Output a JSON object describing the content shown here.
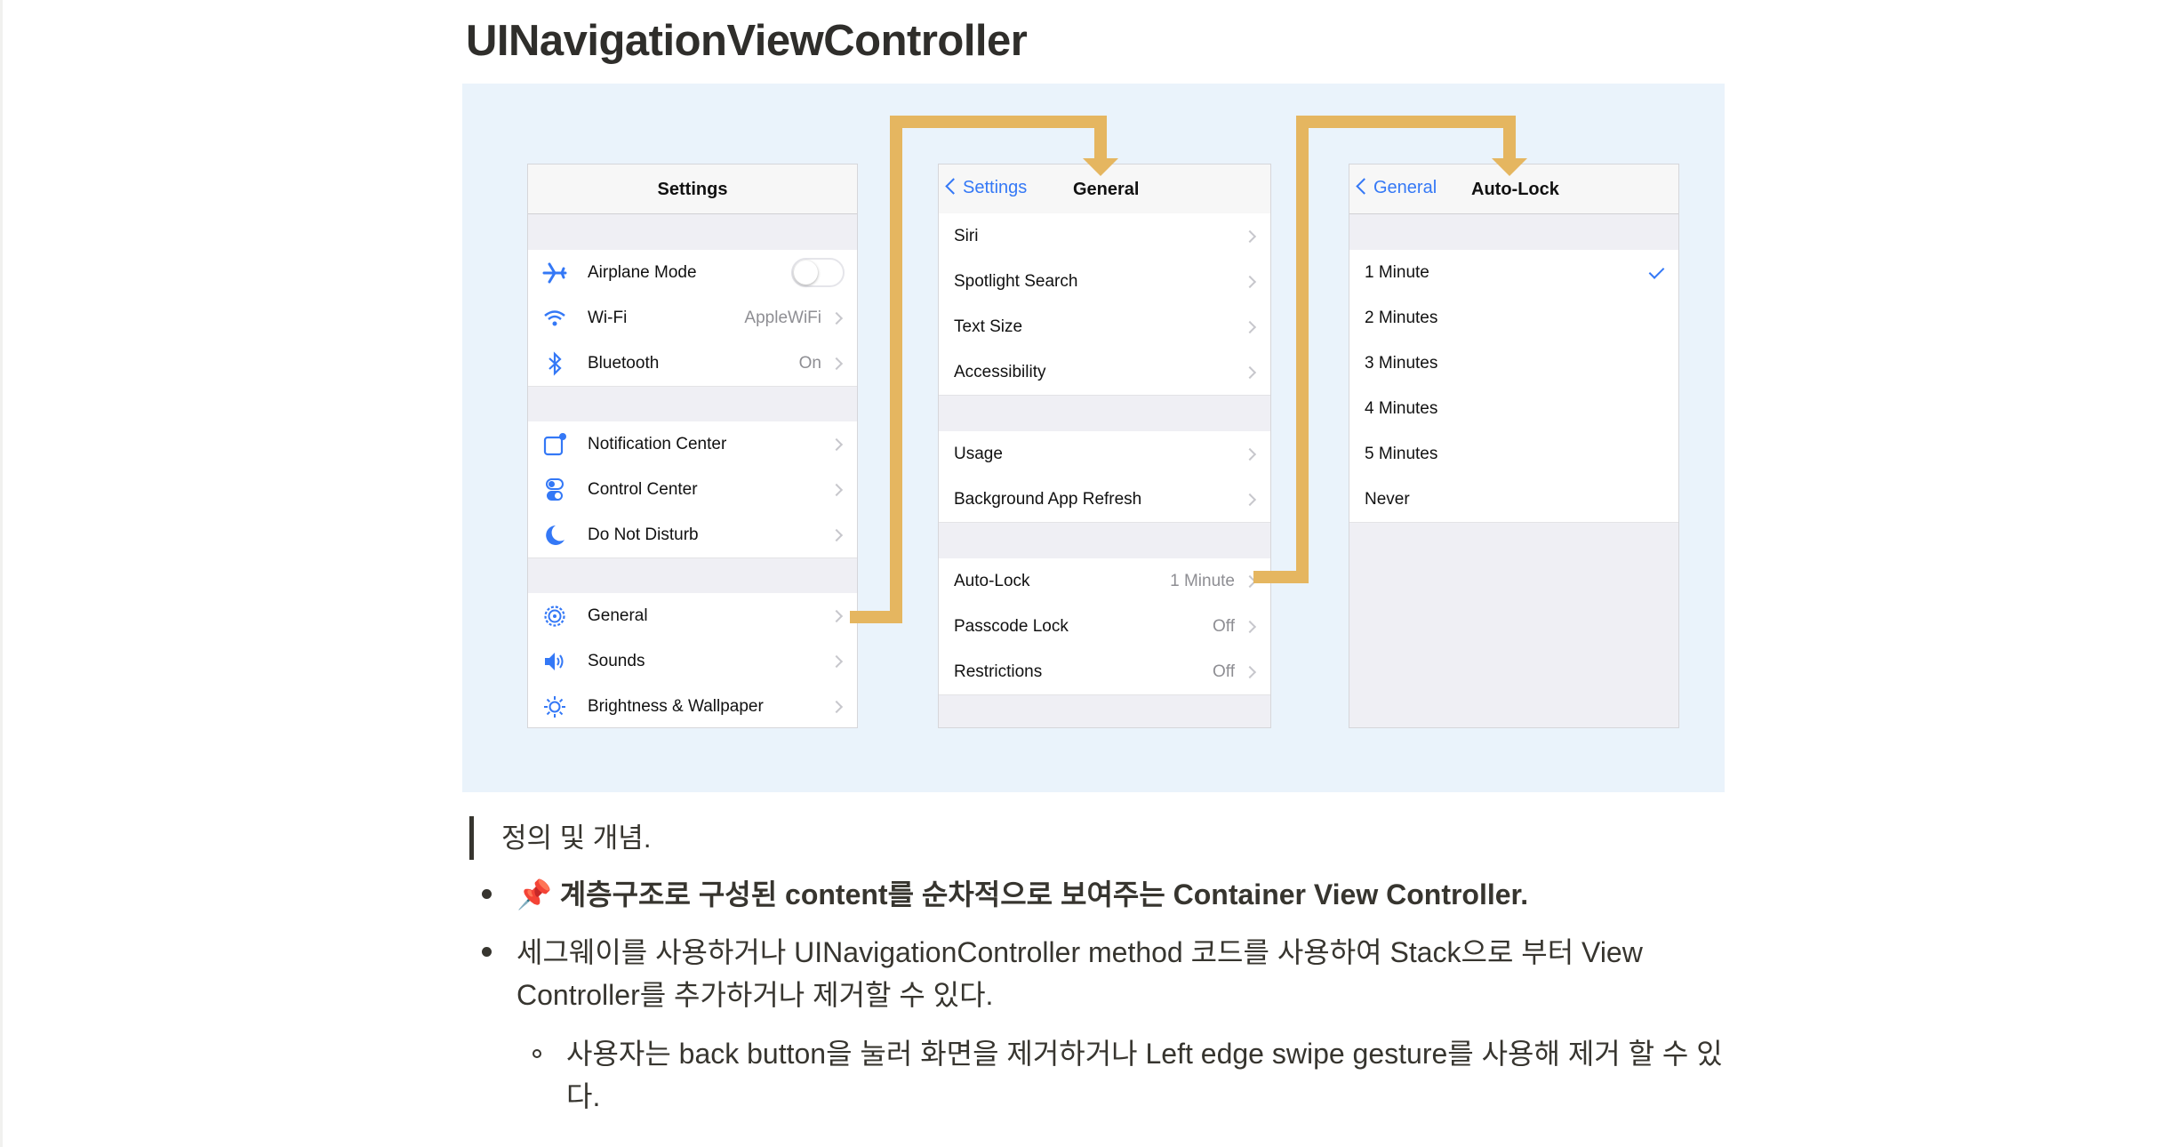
{
  "page": {
    "title": "UINavigationViewController",
    "quote": "정의 및 개념."
  },
  "bullets": [
    {
      "emoji": "📌",
      "text": "계층구조로 구성된 content를 순차적으로 보여주는 Container View Controller."
    },
    {
      "line1": "세그웨이를 사용하거나 UINavigationController method 코드를 사용하여 Stack으로 부터 View",
      "line2": "Controller를 추가하거나 제거할 수 있다."
    }
  ],
  "sub_bullets": [
    {
      "line1": "사용자는 back button을 눌러 화면을 제거하거나 Left edge swipe gesture를 사용해 제거 할 수 있",
      "line2": "다."
    }
  ],
  "figure": {
    "connector_color": "#e5b660",
    "accent_color": "#3478f6",
    "settings_screen": {
      "nav_title": "Settings",
      "items": [
        {
          "label": "Airplane Mode",
          "icon": "airplane-icon",
          "accessory": "toggle",
          "toggle_on": false
        },
        {
          "label": "Wi-Fi",
          "icon": "wifi-icon",
          "value": "AppleWiFi"
        },
        {
          "label": "Bluetooth",
          "icon": "bluetooth-icon",
          "value": "On"
        },
        {
          "label": "Notification Center",
          "icon": "notification-center-icon"
        },
        {
          "label": "Control Center",
          "icon": "control-center-icon"
        },
        {
          "label": "Do Not Disturb",
          "icon": "moon-icon"
        },
        {
          "label": "General",
          "icon": "gear-icon"
        },
        {
          "label": "Sounds",
          "icon": "speaker-icon"
        },
        {
          "label": "Brightness & Wallpaper",
          "icon": "sun-icon"
        }
      ]
    },
    "general_screen": {
      "back_label": "Settings",
      "nav_title": "General",
      "items": [
        {
          "label": "Siri"
        },
        {
          "label": "Spotlight Search"
        },
        {
          "label": "Text Size"
        },
        {
          "label": "Accessibility"
        },
        {
          "label": "Usage"
        },
        {
          "label": "Background App Refresh"
        },
        {
          "label": "Auto-Lock",
          "value": "1 Minute"
        },
        {
          "label": "Passcode Lock",
          "value": "Off"
        },
        {
          "label": "Restrictions",
          "value": "Off"
        }
      ]
    },
    "autolock_screen": {
      "back_label": "General",
      "nav_title": "Auto-Lock",
      "items": [
        {
          "label": "1 Minute",
          "selected": true
        },
        {
          "label": "2 Minutes"
        },
        {
          "label": "3 Minutes"
        },
        {
          "label": "4 Minutes"
        },
        {
          "label": "5 Minutes"
        },
        {
          "label": "Never"
        }
      ]
    }
  }
}
